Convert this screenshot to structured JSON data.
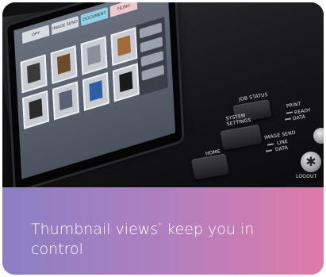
{
  "caption": {
    "text": "Thumbnail views",
    "footnote_mark": "*",
    "text_rest": " keep you in control"
  },
  "device": {
    "screen_tabs": [
      "OPY",
      "IMAGE SEND",
      "DOCUMENT",
      "FILING"
    ],
    "buttons": {
      "job_status": "JOB STATUS",
      "system_settings": "SYSTEM SETTINGS",
      "home": "HOME",
      "logout": "LOGOUT"
    },
    "indicators": {
      "print": "PRINT",
      "ready": "READY",
      "data": "DATA",
      "image_send": "IMAGE SEND",
      "line": "LINE",
      "data2": "DATA"
    },
    "logout_symbol": "✱"
  },
  "colors": {
    "caption_gradient_start": "#8a7fc4",
    "caption_gradient_end": "#e07aa8",
    "tab_active": "#8fd0e6"
  }
}
